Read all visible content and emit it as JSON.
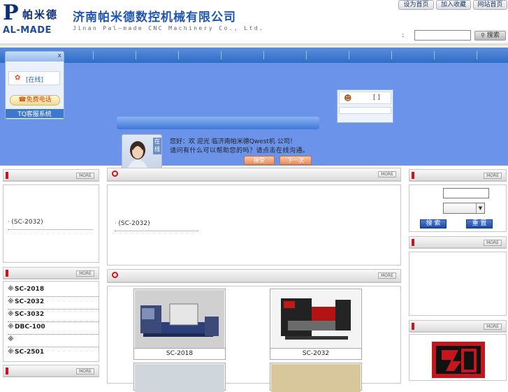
{
  "header": {
    "logo_cn": "帕米德",
    "logo_en": "AL-MADE",
    "logo_letter": "P",
    "company_cn": "济南帕米德数控机械有限公司",
    "company_en": "Jinan Pal—made CNC Machinery Co., Ltd.",
    "top_links": [
      "设为首页",
      "加入收藏",
      "网站首页"
    ],
    "search_colon": ":",
    "search_button": "搜索",
    "search_icon": "magnifier-icon"
  },
  "chat_widget": {
    "close": "x",
    "status": "[在线]",
    "freecall": "免费电话",
    "system": "TQ客服系统"
  },
  "userbox": {
    "bracket": "[ ]"
  },
  "chat_popup": {
    "avatar_tag": "在线",
    "line1": "您好：欢 迎光 临济南帕米德Qwest机 公司！",
    "line2": "请问有什么可以帮助您的吗？请点击在线沟通。",
    "btn_accept": "接受",
    "btn_later": "下一次"
  },
  "left_panels": {
    "more_label": "MORE",
    "news_item": "(SC-2032)",
    "product_list": [
      "SC-2018",
      "SC-2032",
      "SC-3032",
      "DBC-100",
      "",
      "SC-2501"
    ]
  },
  "center_panels": {
    "news_item": "(SC-2032)",
    "products": [
      {
        "name": "SC-2018"
      },
      {
        "name": "SC-2032"
      }
    ]
  },
  "right_panels": {
    "search_btn": "搜 索",
    "reset_btn": "重 置"
  },
  "colors": {
    "brand_blue": "#1f56b4",
    "banner_blue": "#6b93ea",
    "accent_red": "#d0121b"
  }
}
